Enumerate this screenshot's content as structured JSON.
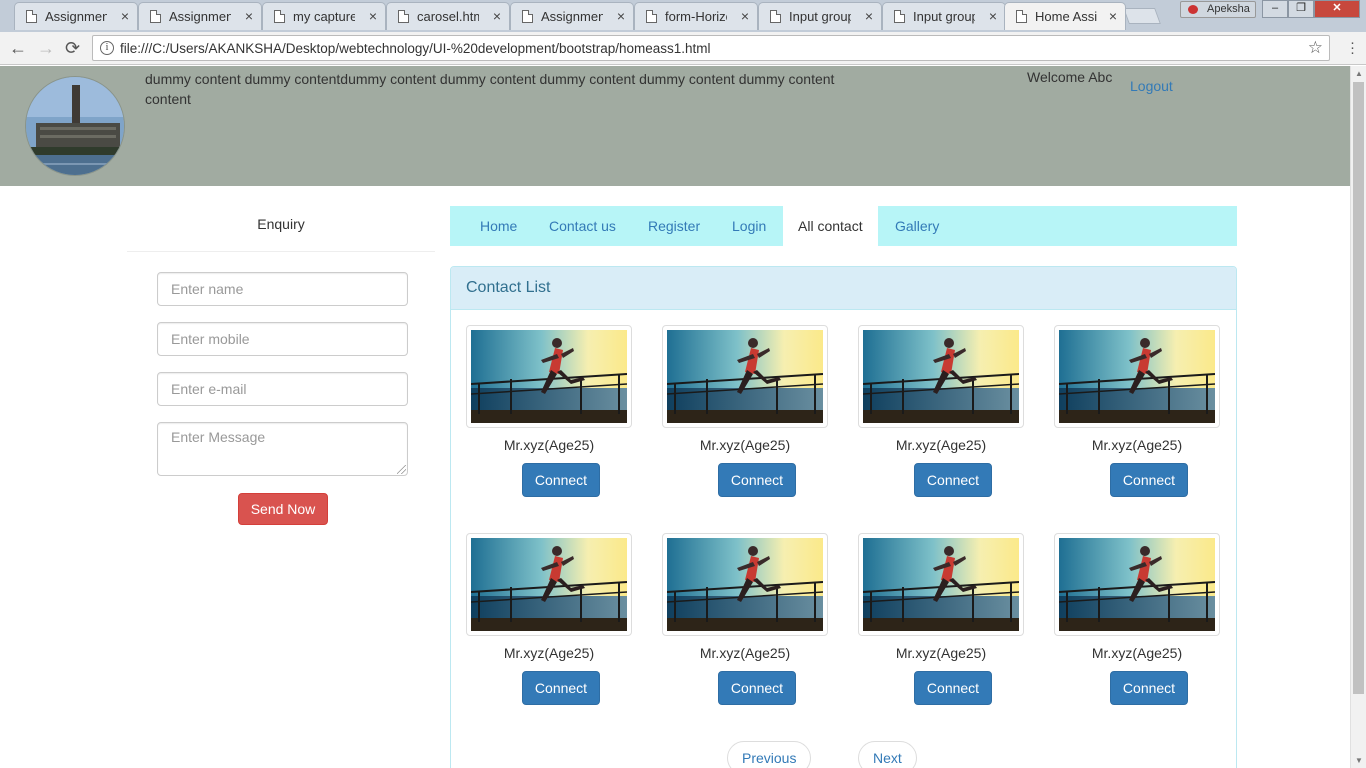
{
  "browser": {
    "tabs": [
      {
        "label": "Assignment",
        "active": false
      },
      {
        "label": "Assignment",
        "active": false
      },
      {
        "label": "my capture",
        "active": false
      },
      {
        "label": "carosel.html",
        "active": false
      },
      {
        "label": "Assignment",
        "active": false
      },
      {
        "label": "form-Horizo",
        "active": false
      },
      {
        "label": "Input group",
        "active": false
      },
      {
        "label": "Input group",
        "active": false
      },
      {
        "label": "Home Assig",
        "active": true
      }
    ],
    "tab_close_glyph": "×",
    "profile_name": "Apeksha",
    "url": "file:///C:/Users/AKANKSHA/Desktop/webtechnology/UI-%20development/bootstrap/homeass1.html",
    "back_glyph": "←",
    "forward_glyph": "→",
    "reload_glyph": "⟳",
    "info_glyph": "i",
    "star_glyph": "☆",
    "window_minimize": "–",
    "window_restore": "❐",
    "window_close": "✕"
  },
  "header": {
    "text": "dummy content dummy contentdummy content dummy content dummy content dummy content dummy content content",
    "welcome": "Welcome Abc",
    "logout": "Logout"
  },
  "enquiry": {
    "title": "Enquiry",
    "name_placeholder": "Enter name",
    "mobile_placeholder": "Enter mobile",
    "email_placeholder": "Enter e-mail",
    "message_placeholder": "Enter Message",
    "send_label": "Send Now"
  },
  "nav": {
    "items": [
      {
        "label": "Home"
      },
      {
        "label": "Contact us"
      },
      {
        "label": "Register"
      },
      {
        "label": "Login"
      },
      {
        "label": "All contact"
      },
      {
        "label": "Gallery"
      }
    ],
    "active_index": 4
  },
  "contacts": {
    "title": "Contact List",
    "cards": [
      {
        "name": "Mr.xyz(Age25)",
        "button": "Connect"
      },
      {
        "name": "Mr.xyz(Age25)",
        "button": "Connect"
      },
      {
        "name": "Mr.xyz(Age25)",
        "button": "Connect"
      },
      {
        "name": "Mr.xyz(Age25)",
        "button": "Connect"
      },
      {
        "name": "Mr.xyz(Age25)",
        "button": "Connect"
      },
      {
        "name": "Mr.xyz(Age25)",
        "button": "Connect"
      },
      {
        "name": "Mr.xyz(Age25)",
        "button": "Connect"
      },
      {
        "name": "Mr.xyz(Age25)",
        "button": "Connect"
      }
    ],
    "pager": {
      "previous": "Previous",
      "next": "Next"
    }
  },
  "colors": {
    "header_bg": "#a1aba1",
    "nav_bg": "#b7f5f7",
    "panel_heading_bg": "#d9edf7",
    "primary_btn": "#337ab7",
    "danger_btn": "#d9534f",
    "link": "#337ab7"
  }
}
